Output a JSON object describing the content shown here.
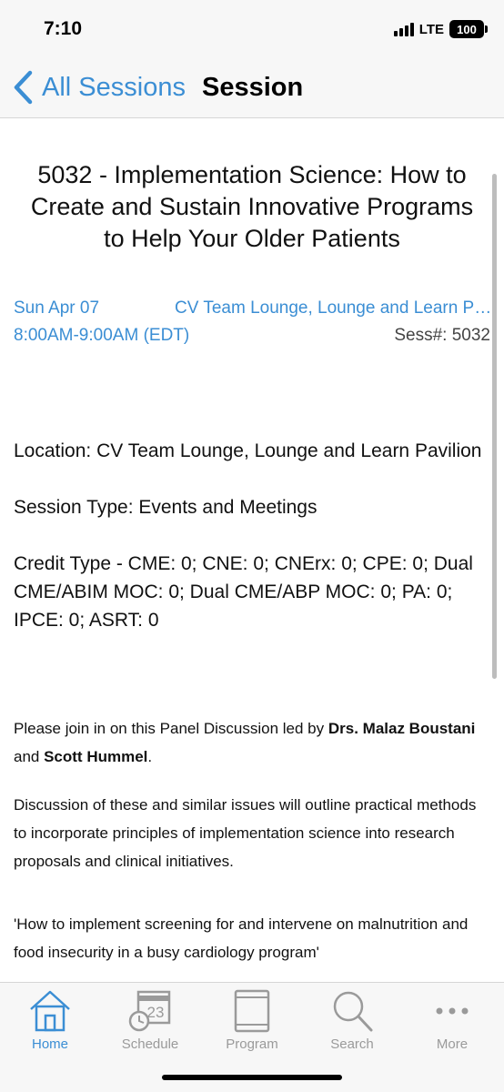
{
  "status_bar": {
    "time": "7:10",
    "network": "LTE",
    "battery": "100"
  },
  "nav": {
    "back_label": "All Sessions",
    "title": "Session"
  },
  "session": {
    "title": "5032 - Implementation Science: How to Create and Sustain Innovative Programs to Help Your Older Patients",
    "date": "Sun Apr 07",
    "room": "CV Team Lounge, Lounge and Learn Pavilion",
    "time": "8:00AM-9:00AM (EDT)",
    "session_number": "Sess#: 5032",
    "location": "Location: CV Team Lounge, Lounge and Learn Pavilion",
    "session_type": "Session Type: Events and Meetings",
    "credit_type": "Credit Type - CME: 0; CNE: 0; CNErx: 0; CPE: 0; Dual CME/ABIM MOC: 0; Dual CME/ABP MOC: 0; PA: 0; IPCE: 0; ASRT: 0"
  },
  "description": {
    "intro_prefix": "Please join in on this Panel Discussion led by ",
    "speaker_1": "Drs. Malaz Boustani",
    "intro_and": " and ",
    "speaker_2": "Scott Hummel",
    "intro_suffix": ".",
    "paragraph_2": "Discussion of these and similar issues will outline practical methods to incorporate principles of implementation science into research proposals and clinical initiatives.",
    "quote": "'How to implement screening for and intervene on malnutrition and food insecurity in a busy cardiology program'"
  },
  "tabs": [
    {
      "label": "Home",
      "icon": "home-icon",
      "active": true
    },
    {
      "label": "Schedule",
      "icon": "calendar-clock-icon",
      "calendar_day": "23",
      "active": false
    },
    {
      "label": "Program",
      "icon": "book-icon",
      "active": false
    },
    {
      "label": "Search",
      "icon": "search-icon",
      "active": false
    },
    {
      "label": "More",
      "icon": "more-dots-icon",
      "active": false
    }
  ],
  "colors": {
    "accent": "#3b8ed4",
    "inactive_tab": "#9a9a9a",
    "bar_background": "#f7f7f7"
  }
}
